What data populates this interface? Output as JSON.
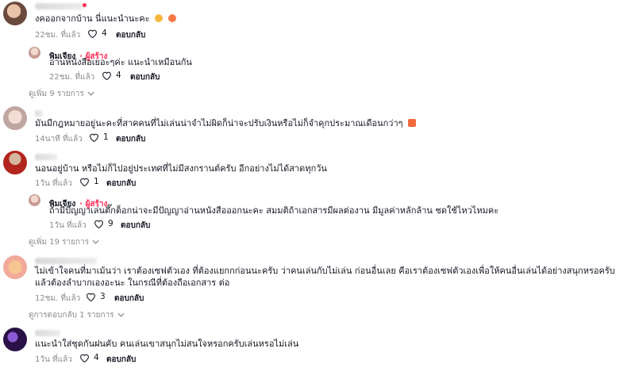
{
  "comments": [
    {
      "text": "งคออกจากบ้าน นี่แนะนำนะคะ",
      "time": "22ชม. ที่แล้ว",
      "likes": "4",
      "reply_label": "ตอบกลับ",
      "reply": {
        "author": "พิมเจียง",
        "author_tag": "· ผู้สร้าง",
        "text": "อ่านหนังสือเยอะๆค่ะ แนะนำเหมือนกัน",
        "time": "22ชม. ที่แล้ว",
        "likes": "4",
        "reply_label": "ตอบกลับ"
      },
      "more_label": "ดูเพิ่ม 9 รายการ"
    },
    {
      "text": "มันมีกฎหมายอยู่นะคะที่สาคคนที่ไม่เล่นน่าจำไม่ผิดก็น่าจะปรับเงินหรือไม่ก็จำคุกประมาณเดือนกว่าๆ",
      "time": "14นาที ที่แล้ว",
      "likes": "1",
      "reply_label": "ตอบกลับ"
    },
    {
      "text": "นอนอยู่บ้าน หรือไม่ก็ไปอยู่ประเทศที่ไม่มีสงกรานต์ครับ อีกอย่างไม่ได้สาดทุกวัน",
      "time": "1วัน ที่แล้ว",
      "likes": "1",
      "reply_label": "ตอบกลับ",
      "reply": {
        "author": "พิมเจียง",
        "author_tag": "· ผู้สร้าง",
        "text": "ถ้ามีปัญญาเล่นตึ๊กต็อกน่าจะมีปัญญาอ่านหนังสือออกนะคะ สมมติถ้าเอกสารมีผลต่องาน มีมูลค่าหลักล้าน ชดใช้ไหวไหมคะ",
        "time": "1วัน ที่แล้ว",
        "likes": "9",
        "reply_label": "ตอบกลับ"
      },
      "more_label": "ดูเพิ่ม 19 รายการ"
    },
    {
      "text": "ไม่เข้าใจคนที่มาเม้นว่า เราต้องเซฟตัวเอง ที่ต้องแยกกก่อนนะครับ ว่าคนเล่นกับไม่เล่น ก่อนอื่นเลย คือเราต้องเซฟตัวเองเพื่อให้คนอื่นเล่นได้อย่างสนุกหรอครับ แล้วต้องลำบากเองอะนะ ในกรณีที่ต้องถือเอกสาร ต่อ",
      "time": "12ชม. ที่แล้ว",
      "likes": "3",
      "reply_label": "ตอบกลับ",
      "more_label": "ดูการตอบกลับ 1 รายการ"
    },
    {
      "text": "แนะนำใส่ชุดกันฝนคับ คนเล่นเขาสนุกไม่สนใจหรอกครับเล่นหรอไม่เล่น",
      "time": "1วัน ที่แล้ว",
      "likes": "4",
      "reply_label": "ตอบกลับ"
    }
  ],
  "icons": {
    "like": "heart-outline-icon",
    "expand": "chevron-down-icon"
  },
  "colors": {
    "creator_tag": "#fe2c55",
    "meta": "#8a8b91",
    "text": "#161823"
  }
}
